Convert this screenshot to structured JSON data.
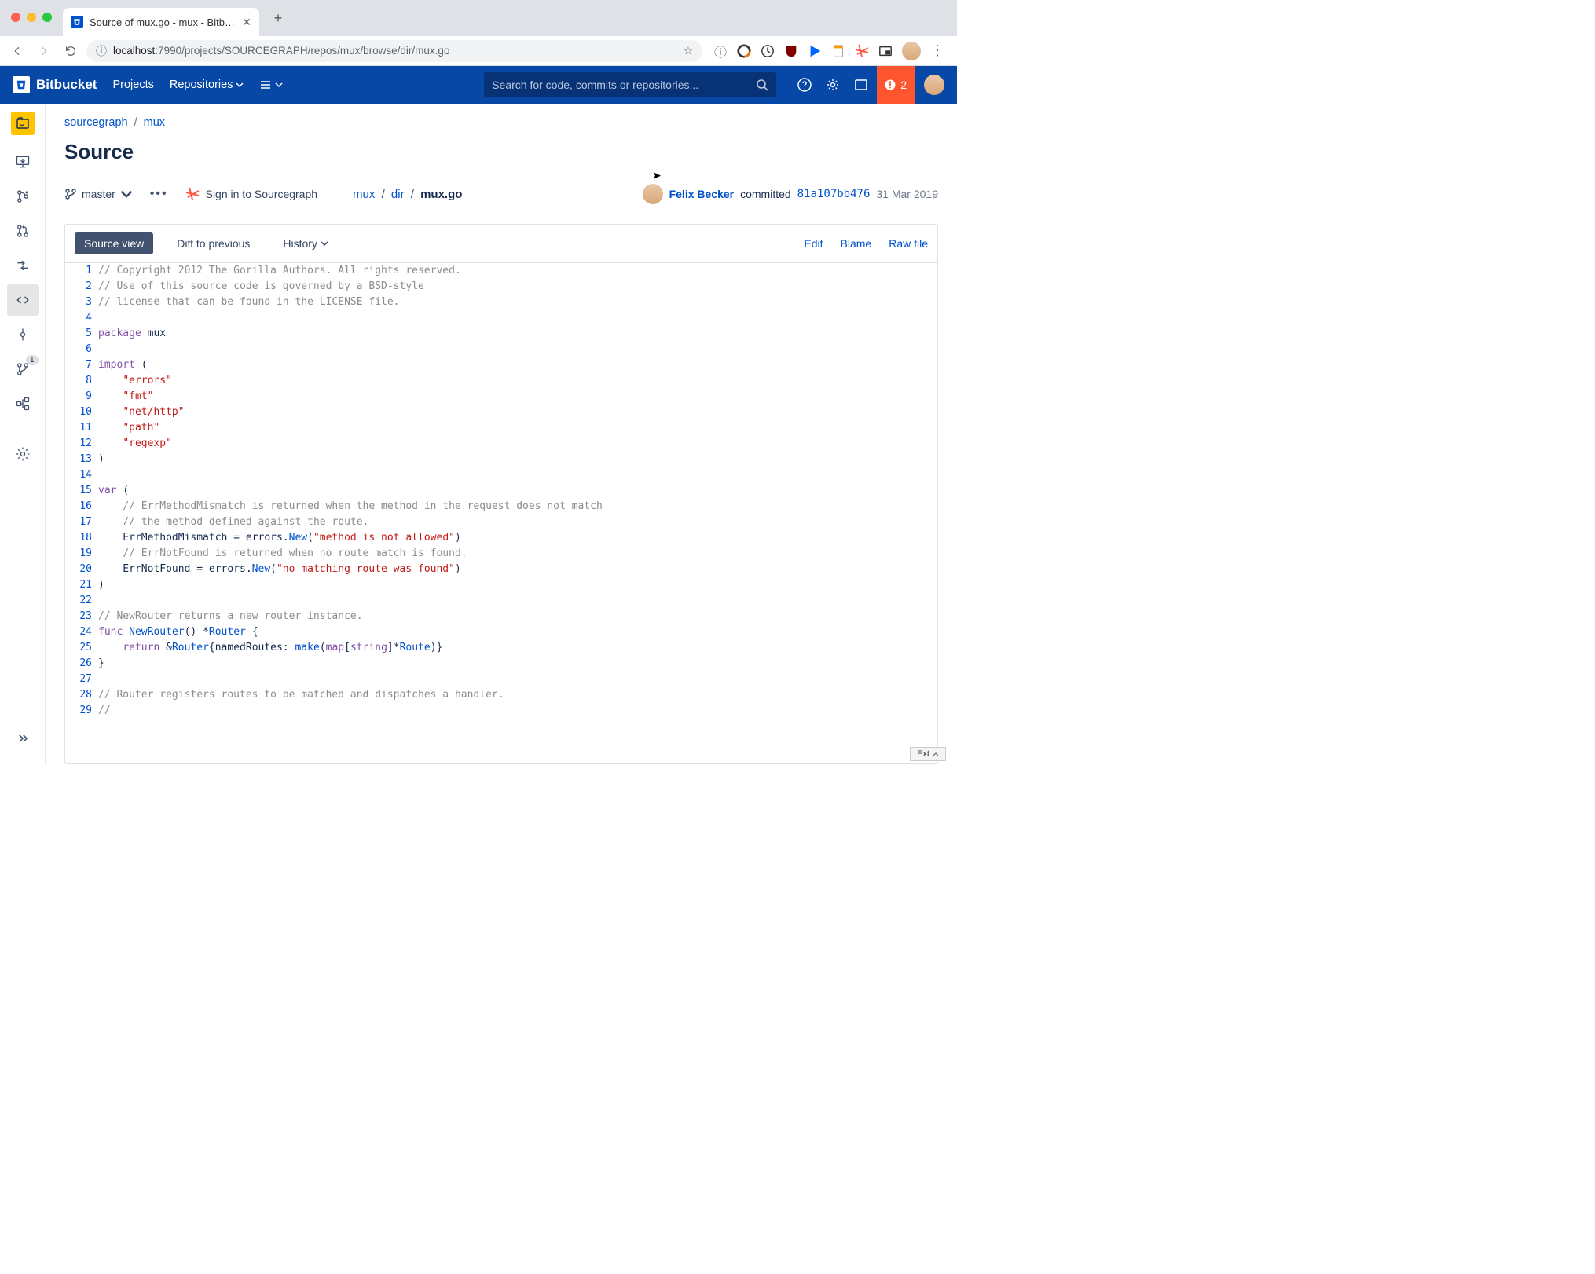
{
  "browser": {
    "tab_title": "Source of mux.go - mux - Bitbuc…",
    "url_host": "localhost",
    "url_port": ":7990",
    "url_path": "/projects/SOURCEGRAPH/repos/mux/browse/dir/mux.go"
  },
  "header": {
    "product": "Bitbucket",
    "nav": {
      "projects": "Projects",
      "repositories": "Repositories"
    },
    "search_placeholder": "Search for code, commits or repositories...",
    "alert_count": "2"
  },
  "breadcrumb": {
    "project": "sourcegraph",
    "repo": "mux"
  },
  "page_title": "Source",
  "branch": "master",
  "sourcegraph_signin": "Sign in to Sourcegraph",
  "path": {
    "d0": "mux",
    "d1": "dir",
    "file": "mux.go"
  },
  "commit": {
    "author": "Felix Becker",
    "verb": "committed",
    "hash": "81a107bb476",
    "date": "31 Mar 2019"
  },
  "file_tabs": {
    "source_view": "Source view",
    "diff": "Diff to previous",
    "history": "History"
  },
  "file_actions": {
    "edit": "Edit",
    "blame": "Blame",
    "raw": "Raw file"
  },
  "code": {
    "lines": [
      {
        "n": 1,
        "s": [
          [
            "comment",
            "// Copyright 2012 The Gorilla Authors. All rights reserved."
          ]
        ]
      },
      {
        "n": 2,
        "s": [
          [
            "comment",
            "// Use of this source code is governed by a BSD-style"
          ]
        ]
      },
      {
        "n": 3,
        "s": [
          [
            "comment",
            "// license that can be found in the LICENSE file."
          ]
        ]
      },
      {
        "n": 4,
        "s": []
      },
      {
        "n": 5,
        "s": [
          [
            "keyword",
            "package"
          ],
          [
            "plain",
            " mux"
          ]
        ]
      },
      {
        "n": 6,
        "s": []
      },
      {
        "n": 7,
        "s": [
          [
            "keyword",
            "import"
          ],
          [
            "plain",
            " ("
          ]
        ]
      },
      {
        "n": 8,
        "s": [
          [
            "plain",
            "    "
          ],
          [
            "string",
            "\"errors\""
          ]
        ]
      },
      {
        "n": 9,
        "s": [
          [
            "plain",
            "    "
          ],
          [
            "string",
            "\"fmt\""
          ]
        ]
      },
      {
        "n": 10,
        "s": [
          [
            "plain",
            "    "
          ],
          [
            "string",
            "\"net/http\""
          ]
        ]
      },
      {
        "n": 11,
        "s": [
          [
            "plain",
            "    "
          ],
          [
            "string",
            "\"path\""
          ]
        ]
      },
      {
        "n": 12,
        "s": [
          [
            "plain",
            "    "
          ],
          [
            "string",
            "\"regexp\""
          ]
        ]
      },
      {
        "n": 13,
        "s": [
          [
            "plain",
            ")"
          ]
        ]
      },
      {
        "n": 14,
        "s": []
      },
      {
        "n": 15,
        "s": [
          [
            "keyword",
            "var"
          ],
          [
            "plain",
            " ("
          ]
        ]
      },
      {
        "n": 16,
        "s": [
          [
            "plain",
            "    "
          ],
          [
            "comment",
            "// ErrMethodMismatch is returned when the method in the request does not match"
          ]
        ]
      },
      {
        "n": 17,
        "s": [
          [
            "plain",
            "    "
          ],
          [
            "comment",
            "// the method defined against the route."
          ]
        ]
      },
      {
        "n": 18,
        "s": [
          [
            "plain",
            "    ErrMethodMismatch = errors."
          ],
          [
            "func",
            "New"
          ],
          [
            "plain",
            "("
          ],
          [
            "string",
            "\"method is not allowed\""
          ],
          [
            "plain",
            ")"
          ]
        ]
      },
      {
        "n": 19,
        "s": [
          [
            "plain",
            "    "
          ],
          [
            "comment",
            "// ErrNotFound is returned when no route match is found."
          ]
        ]
      },
      {
        "n": 20,
        "s": [
          [
            "plain",
            "    ErrNotFound = errors."
          ],
          [
            "func",
            "New"
          ],
          [
            "plain",
            "("
          ],
          [
            "string",
            "\"no matching route was found\""
          ],
          [
            "plain",
            ")"
          ]
        ]
      },
      {
        "n": 21,
        "s": [
          [
            "plain",
            ")"
          ]
        ]
      },
      {
        "n": 22,
        "s": []
      },
      {
        "n": 23,
        "s": [
          [
            "comment",
            "// NewRouter returns a new router instance."
          ]
        ]
      },
      {
        "n": 24,
        "s": [
          [
            "keyword",
            "func"
          ],
          [
            "plain",
            " "
          ],
          [
            "func",
            "NewRouter"
          ],
          [
            "plain",
            "() *"
          ],
          [
            "type",
            "Router"
          ],
          [
            "plain",
            " {"
          ]
        ]
      },
      {
        "n": 25,
        "s": [
          [
            "plain",
            "    "
          ],
          [
            "keyword",
            "return"
          ],
          [
            "plain",
            " &"
          ],
          [
            "type",
            "Router"
          ],
          [
            "plain",
            "{namedRoutes: "
          ],
          [
            "func",
            "make"
          ],
          [
            "plain",
            "("
          ],
          [
            "keyword",
            "map"
          ],
          [
            "plain",
            "["
          ],
          [
            "keyword",
            "string"
          ],
          [
            "plain",
            "]*"
          ],
          [
            "type",
            "Route"
          ],
          [
            "plain",
            ")}"
          ]
        ]
      },
      {
        "n": 26,
        "s": [
          [
            "plain",
            "}"
          ]
        ]
      },
      {
        "n": 27,
        "s": []
      },
      {
        "n": 28,
        "s": [
          [
            "comment",
            "// Router registers routes to be matched and dispatches a handler."
          ]
        ]
      },
      {
        "n": 29,
        "s": [
          [
            "comment",
            "//"
          ]
        ]
      }
    ]
  },
  "ext_badge": "Ext"
}
